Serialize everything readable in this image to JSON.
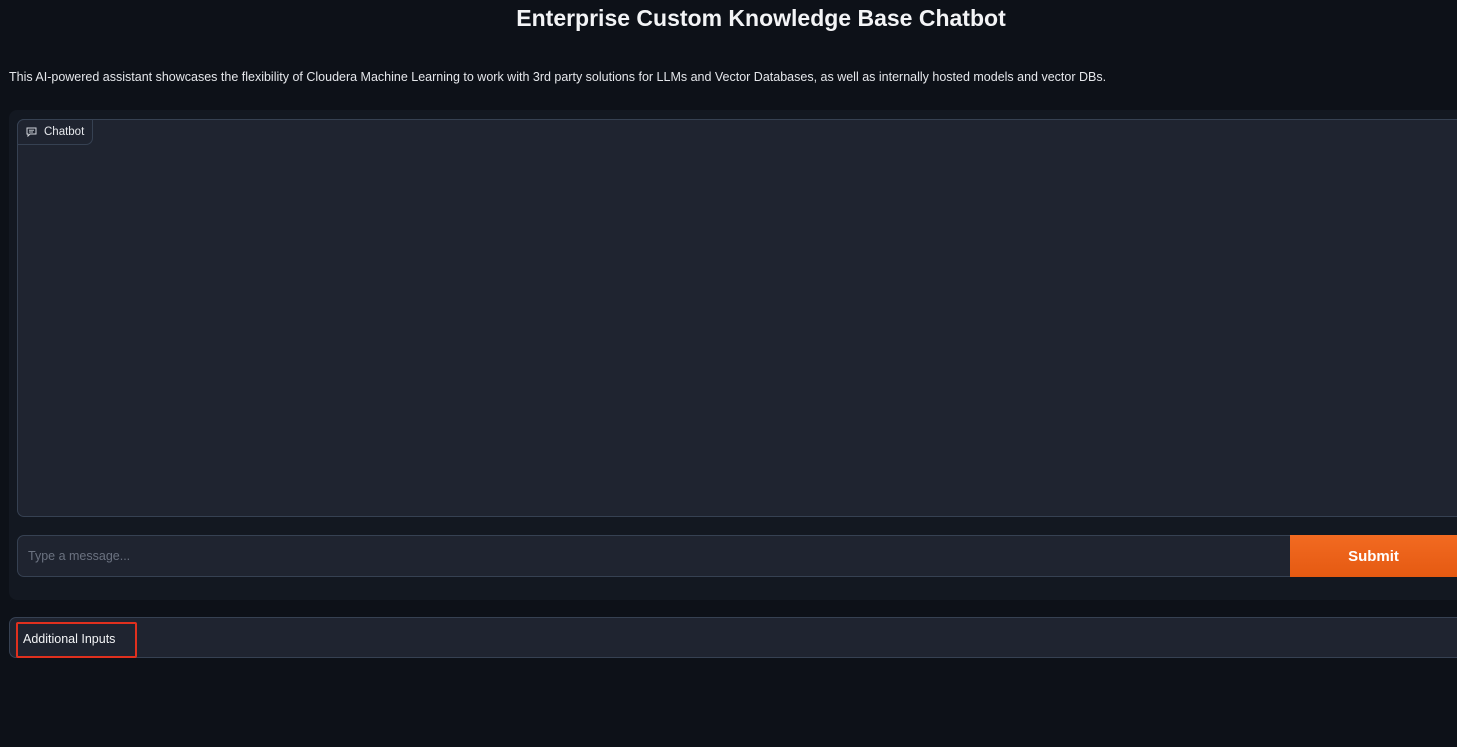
{
  "header": {
    "title": "Enterprise Custom Knowledge Base Chatbot",
    "description": "This AI-powered assistant showcases the flexibility of Cloudera Machine Learning to work with 3rd party solutions for LLMs and Vector Databases, as well as internally hosted models and vector DBs."
  },
  "chatbot": {
    "label": "Chatbot",
    "icon": "chat-bubble-icon"
  },
  "composer": {
    "placeholder": "Type a message...",
    "value": "",
    "submit_label": "Submit"
  },
  "accordion": {
    "label": "Additional Inputs"
  },
  "colors": {
    "background": "#0d1118",
    "panel": "#1f2430",
    "border": "#364152",
    "accent": "#f26a21",
    "highlight": "#e0301e"
  }
}
